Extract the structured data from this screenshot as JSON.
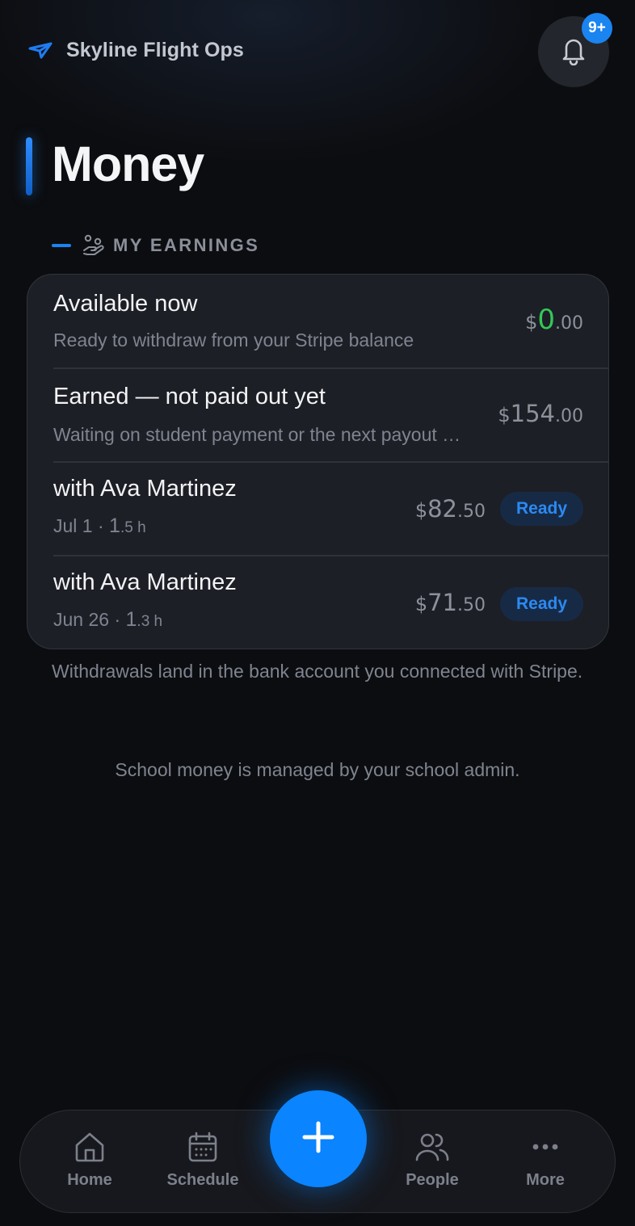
{
  "header": {
    "brand_icon": "paper-plane-icon",
    "app_name": "Skyline Flight Ops",
    "notification_badge": "9+"
  },
  "page": {
    "title": "Money"
  },
  "earnings": {
    "section_label": "MY EARNINGS",
    "section_icon": "hand-coins-icon",
    "available": {
      "title": "Available now",
      "subtitle": "Ready to withdraw from your Stripe balance",
      "currency": "$",
      "whole": "0",
      "cents": ".00",
      "color": "#34c759"
    },
    "pending": {
      "title": "Earned — not paid out yet",
      "subtitle": "Waiting on student payment or the next payout …",
      "currency": "$",
      "whole": "154",
      "cents": ".00"
    },
    "lessons": [
      {
        "title": "with Ava Martinez",
        "date": "Jul 1",
        "separator": " · ",
        "hours_whole": "1",
        "hours_frac": ".5 h",
        "currency": "$",
        "whole": "82",
        "cents": ".50",
        "status": "Ready"
      },
      {
        "title": "with Ava Martinez",
        "date": "Jun 26",
        "separator": " · ",
        "hours_whole": "1",
        "hours_frac": ".3 h",
        "currency": "$",
        "whole": "71",
        "cents": ".50",
        "status": "Ready"
      }
    ]
  },
  "notes": {
    "withdrawals": "Withdrawals land in the bank account you connected with Stripe.",
    "school": "School money is managed by your school admin."
  },
  "nav": {
    "items": [
      {
        "label": "Home",
        "icon": "home-icon"
      },
      {
        "label": "Schedule",
        "icon": "calendar-icon"
      },
      {
        "label": "People",
        "icon": "people-icon"
      },
      {
        "label": "More",
        "icon": "more-icon"
      }
    ],
    "fab_icon": "plus-icon"
  },
  "colors": {
    "accent": "#0a84ff",
    "status_ready_bg": "#172a45",
    "status_ready_text": "#2b8af4",
    "background": "#0c0d10",
    "card": "#1d1f26"
  }
}
